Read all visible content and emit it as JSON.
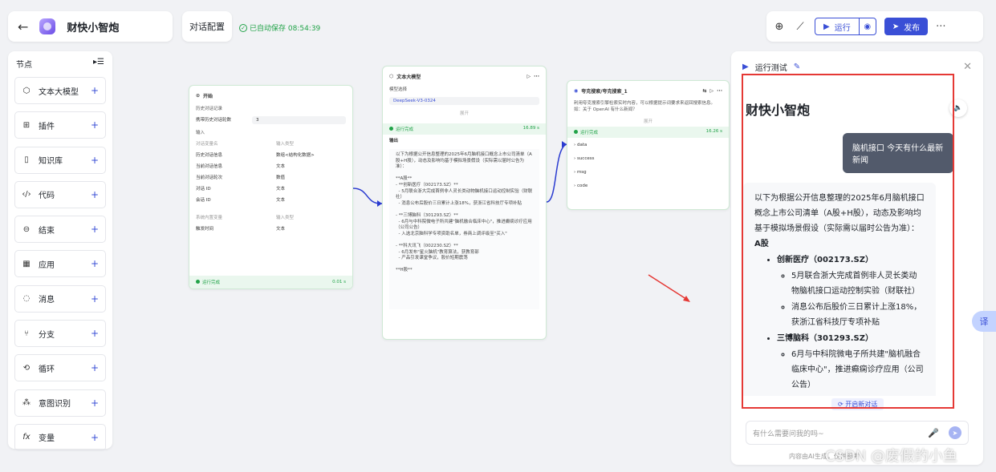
{
  "app": {
    "title": "财快小智炮"
  },
  "header": {
    "config_tab": "对话配置",
    "autosave": "已自动保存 08:54:39"
  },
  "toolbar": {
    "run_label": "运行",
    "publish_label": "发布"
  },
  "sidebar": {
    "title": "节点",
    "items": [
      {
        "label": "文本大模型",
        "icon": "cube-icon"
      },
      {
        "label": "插件",
        "icon": "plugin-icon"
      },
      {
        "label": "知识库",
        "icon": "book-icon"
      },
      {
        "label": "代码",
        "icon": "code-icon"
      },
      {
        "label": "结束",
        "icon": "end-icon"
      },
      {
        "label": "应用",
        "icon": "grid-icon"
      },
      {
        "label": "消息",
        "icon": "message-icon"
      },
      {
        "label": "分支",
        "icon": "branch-icon"
      },
      {
        "label": "循环",
        "icon": "loop-icon"
      },
      {
        "label": "意图识别",
        "icon": "intent-icon"
      },
      {
        "label": "变量",
        "icon": "fx-icon"
      }
    ]
  },
  "node_start": {
    "title": "开始",
    "history_label": "历史对话记录",
    "rounds_label": "携带历史对话轮数",
    "rounds_value": "3",
    "input_label": "输入",
    "col_var": "对话变量名",
    "col_type": "输入类型",
    "rows": [
      {
        "name": "历史对话信息",
        "type": "数组<结构化数据>"
      },
      {
        "name": "当前对话信息",
        "type": "文本"
      },
      {
        "name": "当前对话轮次",
        "type": "数值"
      },
      {
        "name": "对话 ID",
        "type": "文本"
      },
      {
        "name": "会话 ID",
        "type": "文本"
      }
    ],
    "sys_label": "系统内置变量",
    "sys_col": "输入类型",
    "sys_rows": [
      {
        "name": "触发时间",
        "type": "文本"
      }
    ],
    "status": "运行完成",
    "time": "0.01 s"
  },
  "node_llm": {
    "title": "文本大模型",
    "model_label": "模型选择",
    "model_value": "DeepSeek-V3-0324",
    "expand": "展开",
    "status": "运行完成",
    "time": "16.89 s",
    "output_label": "输出",
    "output_text": "以下为根据公开信息整理的2025年6月脑机接口概念上市公司清单（A股+H股），动态及影响均基于模拟场景假设（实际需以届时公告为准）：\n\n**A股**\n- **创新医疗（002173.SZ）**\n  - 5月联合浙大完成首例非人灵长类动物脑机接口运动控制实验（财联社）\n  - 消息公布后股价三日累计上涨18%，获浙江省科技厅专项补贴\n\n- **三博脑科（301293.SZ）**\n  - 6月与中科院微电子所共建\"脑机融合临床中心\"，推进癫痫诊疗应用（公司公告）\n  - 入选北京脑科学专项资助名单，券商上调评级至\"买入\"\n\n- **科大讯飞（002230.SZ）**\n  - 6月发布\"星火脑机\"教育算法，获教育部\n  - 产品引发课堂争议，股价短期震荡\n\n**H股**"
  },
  "node_search": {
    "title": "夸克搜索/夸克搜索_1",
    "desc": "利用夸克搜索引擎检索实时内容，可以根据提示词要求来返回搜索信息。如：关于 OpenAI 有什么新闻？",
    "expand": "展开",
    "status": "运行完成",
    "time": "16.26 s",
    "outputs": [
      "data",
      "success",
      "msg",
      "code"
    ]
  },
  "panel": {
    "title": "运行测试",
    "app_name": "财快小智炮",
    "user_message": "脑机接口 今天有什么最新新闻",
    "answer_intro": "以下为根据公开信息整理的2025年6月脑机接口概念上市公司清单（A股+H股），动态及影响均基于模拟场景假设（实际需以届时公告为准）：",
    "section": "A股",
    "companies": [
      {
        "name": "创新医疗（002173.SZ）",
        "points": [
          "5月联合浙大完成首例非人灵长类动物脑机接口运动控制实验（财联社）",
          "消息公布后股价三日累计上涨18%，获浙江省科技厅专项补贴"
        ]
      },
      {
        "name": "三博脑科（301293.SZ）",
        "points": [
          "6月与中科院微电子所共建\"脑机融合临床中心\"，推进癫痫诊疗应用（公司公告）"
        ]
      }
    ],
    "new_chat": "开启新对话",
    "input_placeholder": "有什么需要问我的吗~",
    "disclaimer": "内容由AI生成，仅供参考"
  },
  "float_button": "译",
  "watermark": "CSDN @废假的小鱼",
  "colors": {
    "accent": "#3a4fd6",
    "success": "#21a348",
    "annotation": "#e53935"
  }
}
